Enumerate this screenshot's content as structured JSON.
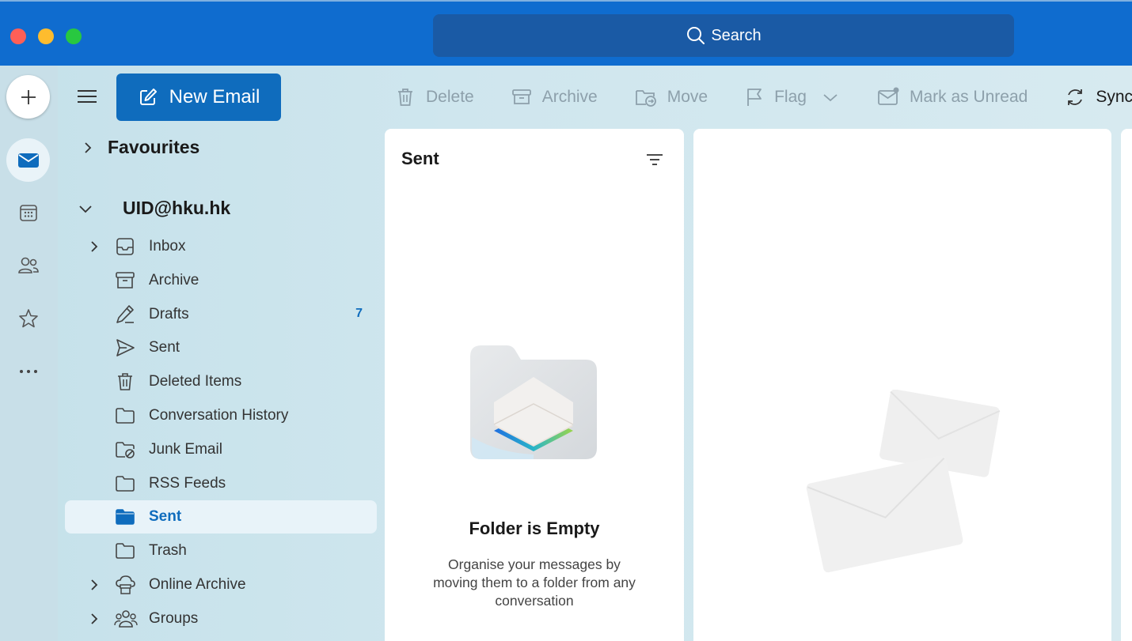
{
  "window": {
    "search_label": "Search"
  },
  "rail": {
    "items": [
      "add",
      "mail",
      "calendar",
      "people",
      "favourites",
      "more"
    ]
  },
  "compose": {
    "new_email_label": "New Email"
  },
  "toolbar": {
    "delete_label": "Delete",
    "archive_label": "Archive",
    "move_label": "Move",
    "flag_label": "Flag",
    "mark_unread_label": "Mark as Unread",
    "sync_label": "Sync"
  },
  "sidebar": {
    "favourites_label": "Favourites",
    "account_label": "UID@hku.hk",
    "folders": [
      {
        "label": "Inbox",
        "icon": "inbox-icon",
        "count": "",
        "expandable": true
      },
      {
        "label": "Archive",
        "icon": "archive-icon",
        "count": "",
        "expandable": false
      },
      {
        "label": "Drafts",
        "icon": "drafts-icon",
        "count": "7",
        "expandable": false
      },
      {
        "label": "Sent",
        "icon": "send-icon",
        "count": "",
        "expandable": false
      },
      {
        "label": "Deleted Items",
        "icon": "trash-icon",
        "count": "",
        "expandable": false
      },
      {
        "label": "Conversation History",
        "icon": "folder-icon",
        "count": "",
        "expandable": false
      },
      {
        "label": "Junk Email",
        "icon": "junk-folder-icon",
        "count": "",
        "expandable": false
      },
      {
        "label": "RSS Feeds",
        "icon": "folder-icon",
        "count": "",
        "expandable": false
      },
      {
        "label": "Sent",
        "icon": "folder-filled-icon",
        "count": "",
        "expandable": false,
        "selected": true
      },
      {
        "label": "Trash",
        "icon": "folder-icon",
        "count": "",
        "expandable": false
      },
      {
        "label": "Online Archive",
        "icon": "cloud-archive-icon",
        "count": "",
        "expandable": true
      },
      {
        "label": "Groups",
        "icon": "groups-icon",
        "count": "",
        "expandable": true
      }
    ]
  },
  "message_list": {
    "title": "Sent",
    "empty_title": "Folder is Empty",
    "empty_body": "Organise your messages by moving them to a folder from any conversation"
  },
  "colors": {
    "brand": "#0f6cbd",
    "pane_bg": "#c8dfe8",
    "selected_bg": "#e8f3f9"
  }
}
